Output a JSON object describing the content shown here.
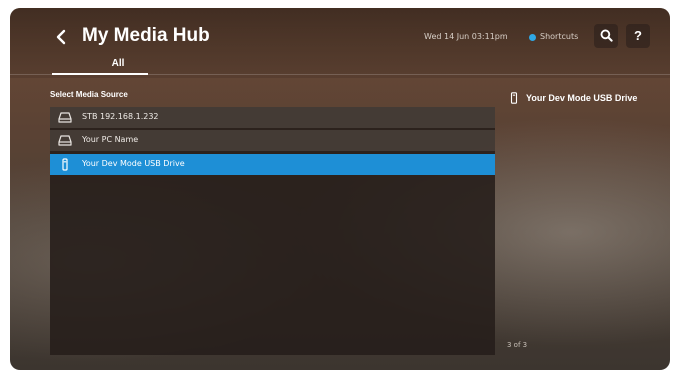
{
  "header": {
    "back_icon": "chevron-left-icon",
    "title": "My Media Hub",
    "tabs": [
      {
        "label": "All",
        "active": true
      }
    ],
    "clock": "Wed 14 Jun 03:11pm",
    "shortcuts_label": "Shortcuts",
    "shortcuts_dot_color": "#2fa8e6",
    "search_icon": "search-icon",
    "help_label": "?"
  },
  "main": {
    "section_label": "Select Media Source",
    "sources": [
      {
        "label": "STB 192.168.1.232",
        "icon": "hard-drive-icon",
        "selected": false
      },
      {
        "label": "Your PC Name",
        "icon": "hard-drive-icon",
        "selected": false
      },
      {
        "label": "Your Dev Mode USB Drive",
        "icon": "usb-drive-icon",
        "selected": true
      }
    ],
    "selection_color": "#1e8fd6"
  },
  "preview": {
    "title": "Your Dev Mode USB Drive",
    "icon": "usb-drive-icon",
    "page_count": "3 of 3"
  }
}
